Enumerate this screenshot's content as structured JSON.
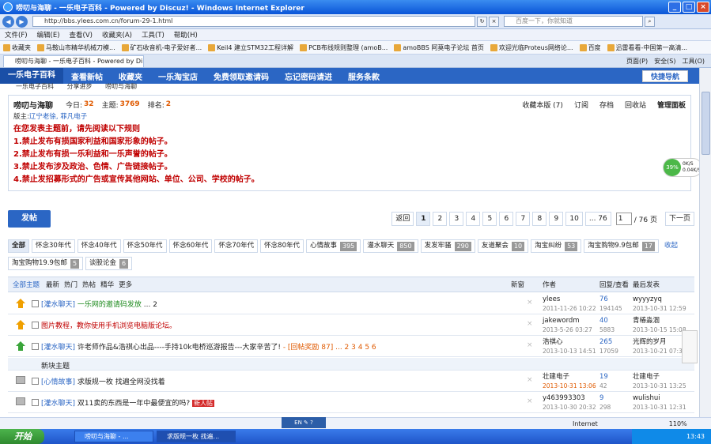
{
  "window": {
    "title": "唠叨与海聊 - 一乐电子百科 - Powered by Discuz! - Windows Internet Explorer"
  },
  "addressbar": {
    "url": "http://bbs.ylees.com.cn/forum-29-1.html",
    "search_placeholder": "百度一下，你就知道"
  },
  "menu": [
    "文件(F)",
    "编辑(E)",
    "查看(V)",
    "收藏夹(A)",
    "工具(T)",
    "帮助(H)"
  ],
  "favorites": [
    "收藏夹",
    "马鞍山市精华机械刀模...",
    "矿石收音机-电子爱好者...",
    "Keil4 建立STM32工程详解",
    "PCB布线规则整理 (amoB...",
    "amoBBS 阿莫电子论坛 首页",
    "欢迎光临Proteus网络论...",
    "百度",
    "迅雷看看-中国第一高清..."
  ],
  "tab": {
    "title": "唠叨与海聊 - 一乐电子百科 - Powered by Di...",
    "tools": [
      "页面(P)",
      "安全(S)",
      "工具(O)"
    ]
  },
  "sitenav": {
    "items": [
      "一乐电子百科",
      "查看新帖",
      "收藏夹",
      "一乐淘宝店",
      "免费领取邀请码",
      "忘记密码请进",
      "服务条款"
    ],
    "quick": "快捷导航"
  },
  "breadcrumb": [
    "一乐电子百科",
    "分享进步",
    "唠叨与海聊"
  ],
  "forum": {
    "name": "唠叨与海聊",
    "today_label": "今日:",
    "today": "32",
    "topics_label": "主题:",
    "topics": "3769",
    "rank_label": "排名:",
    "rank": "2",
    "actions": [
      "收藏本版 (7)",
      "订阅",
      "存档",
      "回收站",
      "管理面板"
    ],
    "mods_label": "版主:",
    "mods": "辽宁老徐, 菲凡电子",
    "rules": [
      "在您发表主题前，请先阅读以下规则",
      "1.禁止发布有损国家利益和国家形象的帖子。",
      "2.禁止发布有损一乐利益和一乐声誉的帖子。",
      "3.禁止发布涉及政治、色情、广告链接帖子。",
      "4.禁止发招募形式的广告或宣传其他网站、单位、公司、学校的帖子。"
    ]
  },
  "post_button": "发帖",
  "pager": {
    "prev": "返回",
    "pages": [
      "1",
      "2",
      "3",
      "4",
      "5",
      "6",
      "7",
      "8",
      "9",
      "10",
      "... 76"
    ],
    "current": "1",
    "total": "/ 76 页",
    "next": "下一页"
  },
  "categories": [
    {
      "name": "全部",
      "count": ""
    },
    {
      "name": "怀念30年代",
      "count": ""
    },
    {
      "name": "怀念40年代",
      "count": ""
    },
    {
      "name": "怀念50年代",
      "count": ""
    },
    {
      "name": "怀念60年代",
      "count": ""
    },
    {
      "name": "怀念70年代",
      "count": ""
    },
    {
      "name": "怀念80年代",
      "count": ""
    },
    {
      "name": "心情故事",
      "count": "395"
    },
    {
      "name": "灌水聊天",
      "count": "850"
    },
    {
      "name": "发发牢骚",
      "count": "290"
    },
    {
      "name": "友道聚会",
      "count": "10"
    },
    {
      "name": "淘宝纠纷",
      "count": "53"
    },
    {
      "name": "淘宝购物9.9包邮",
      "count": "17"
    },
    {
      "name": "淘宝购物19.9包邮",
      "count": "5"
    },
    {
      "name": "谈股论金",
      "count": "6"
    }
  ],
  "collapse": "收起",
  "listhead": {
    "filters": [
      "全部主题",
      "最新",
      "热门",
      "热帖",
      "精华",
      "更多"
    ],
    "newwin": "新窗",
    "author": "作者",
    "replies": "回复/查看",
    "last": "最后发表"
  },
  "threads": [
    {
      "type": "[灌水聊天]",
      "title": "一乐网的邀请码发放",
      "extra": "... 2",
      "author": "ylees",
      "date": "2011-11-26 10:22",
      "replies": "76",
      "views": "194145",
      "last": "wyyyzyq",
      "last_date": "2013-10-31 12:59"
    },
    {
      "type": "",
      "title": "图片教程，教你使用手机浏览电脑版论坛。",
      "extra": "",
      "author": "jakewordm",
      "date": "2013-5-26 03:27",
      "replies": "40",
      "views": "5883",
      "last": "青椿淼涸",
      "last_date": "2013-10-15 15:08"
    },
    {
      "type": "[灌水聊天]",
      "title": "许老师作品&浩祺心出品----手持10k电桥巡游报告---大家辛苦了!",
      "extra": "- [回帖奖励 87]  ... 2 3 4 5 6",
      "author": "浩祺心",
      "date": "2013-10-13 14:51",
      "replies": "265",
      "views": "17059",
      "last": "光辉的岁月",
      "last_date": "2013-10-21 07:32"
    },
    {
      "type": "[心情故事]",
      "title": "求版规一枚 找遍全网没找着",
      "extra": "",
      "author": "壮建电子",
      "date": "2013-10-31 13:06",
      "replies": "19",
      "views": "42",
      "last": "壮建电子",
      "last_date": "2013-10-31 13:25"
    },
    {
      "type": "[灌水聊天]",
      "title": "双11卖的东西是一年中最便宜的吗?",
      "extra": "新人帖",
      "author": "y463993303",
      "date": "2013-10-30 20:32",
      "replies": "9",
      "views": "298",
      "last": "wulishui",
      "last_date": "2013-10-31 12:31"
    }
  ],
  "newtopic": "新块主题",
  "speed": {
    "pct": "39%",
    "up": "0K/S",
    "down": "0.04K/S"
  },
  "status": {
    "zone": "Internet",
    "zoom": "110%"
  },
  "taskbar": {
    "start": "开始",
    "tasks": [
      "唠叨与海聊 - ...",
      "求版规一枚 找遍..."
    ],
    "clock": "13:43"
  }
}
